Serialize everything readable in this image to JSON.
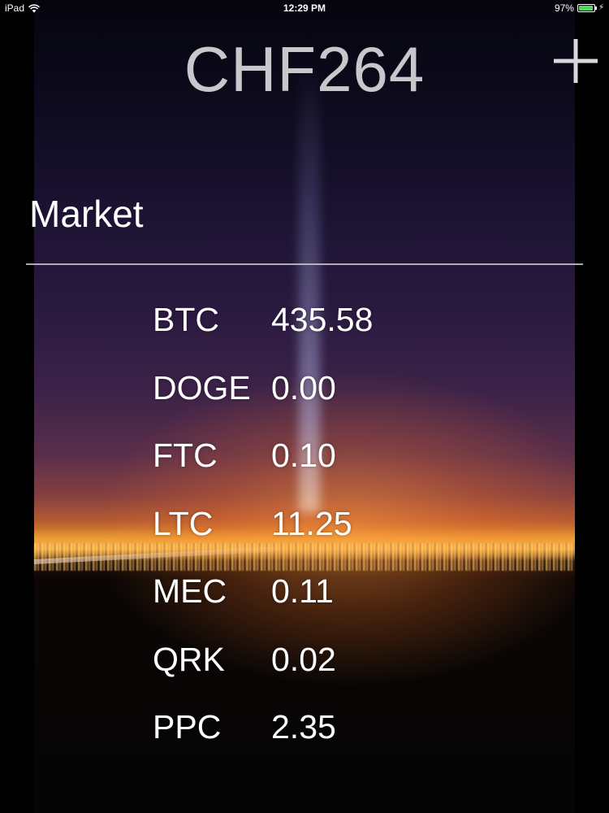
{
  "status_bar": {
    "device": "iPad",
    "time": "12:29 PM",
    "battery_percent_text": "97%",
    "battery_level": 0.97,
    "battery_color": "#4cd964"
  },
  "header": {
    "title": "CHF264",
    "add_icon": "plus-icon"
  },
  "section": {
    "title": "Market"
  },
  "market": {
    "rows": [
      {
        "symbol": "BTC",
        "price": "435.58"
      },
      {
        "symbol": "DOGE",
        "price": "0.00"
      },
      {
        "symbol": "FTC",
        "price": "0.10"
      },
      {
        "symbol": "LTC",
        "price": "11.25"
      },
      {
        "symbol": "MEC",
        "price": "0.11"
      },
      {
        "symbol": "QRK",
        "price": "0.02"
      },
      {
        "symbol": "PPC",
        "price": "2.35"
      }
    ]
  }
}
